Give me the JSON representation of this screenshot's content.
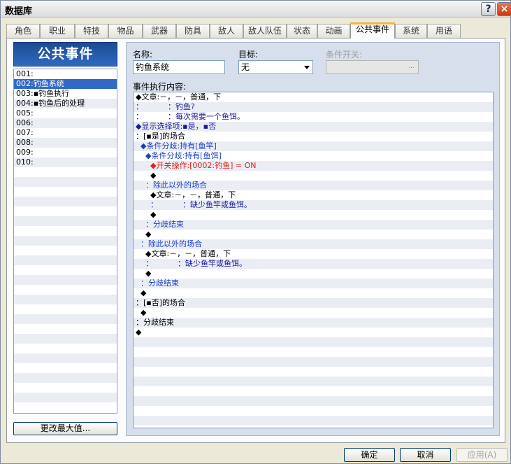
{
  "window": {
    "title": "数据库",
    "help_label": "?",
    "close_label": "×"
  },
  "tabs": [
    {
      "label": "角色"
    },
    {
      "label": "职业"
    },
    {
      "label": "特技"
    },
    {
      "label": "物品"
    },
    {
      "label": "武器"
    },
    {
      "label": "防具"
    },
    {
      "label": "敌人"
    },
    {
      "label": "敌人队伍"
    },
    {
      "label": "状态"
    },
    {
      "label": "动画"
    },
    {
      "label": "公共事件"
    },
    {
      "label": "系统"
    },
    {
      "label": "用语"
    }
  ],
  "active_tab": "公共事件",
  "left": {
    "header": "公共事件",
    "items": [
      {
        "label": "001:"
      },
      {
        "label": "002:钓鱼系统"
      },
      {
        "label": "003:▪钓鱼执行"
      },
      {
        "label": "004:▪钓鱼后的处理"
      },
      {
        "label": "005:"
      },
      {
        "label": "006:"
      },
      {
        "label": "007:"
      },
      {
        "label": "008:"
      },
      {
        "label": "009:"
      },
      {
        "label": "010:"
      }
    ],
    "selected_index": 1,
    "max_button": "更改最大值..."
  },
  "form": {
    "name_label": "名称:",
    "name_value": "钓鱼系统",
    "target_label": "目标:",
    "target_value": "无",
    "switch_label": "条件开关:",
    "switch_button": "...",
    "content_label": "事件执行内容:"
  },
  "commands": [
    {
      "text": "◆文章:－，－，普通，下",
      "color": "#000000"
    },
    {
      "text": "：          ：钓鱼?",
      "color": "#1a1aa0"
    },
    {
      "text": "：          ：每次需要一个鱼饵。",
      "color": "#1a1aa0"
    },
    {
      "text": "◆显示选择项:▪是，▪否",
      "color": "#1a1aa0"
    },
    {
      "text": "：[▪是]的场合",
      "color": "#000000"
    },
    {
      "text": "  ◆条件分歧:持有[鱼竿]",
      "color": "#1a3cc8"
    },
    {
      "text": "    ◆条件分歧:持有[鱼饵]",
      "color": "#1a3cc8"
    },
    {
      "text": "      ◆开关操作:[0002:钓鱼] = ON",
      "color": "#e01c1c"
    },
    {
      "text": "      ◆",
      "color": "#000000"
    },
    {
      "text": "    ：除此以外的场合",
      "color": "#1a3cc8"
    },
    {
      "text": "      ◆文章:－，－，普通，下",
      "color": "#000000"
    },
    {
      "text": "      ：          ：缺少鱼竿或鱼饵。",
      "color": "#1a1aa0"
    },
    {
      "text": "      ◆",
      "color": "#000000"
    },
    {
      "text": "    ：分歧结束",
      "color": "#1a3cc8"
    },
    {
      "text": "    ◆",
      "color": "#000000"
    },
    {
      "text": "  ：除此以外的场合",
      "color": "#1a3cc8"
    },
    {
      "text": "    ◆文章:－，－，普通，下",
      "color": "#000000"
    },
    {
      "text": "    ：          ：缺少鱼竿或鱼饵。",
      "color": "#1a1aa0"
    },
    {
      "text": "    ◆",
      "color": "#000000"
    },
    {
      "text": "  ：分歧结束",
      "color": "#1a3cc8"
    },
    {
      "text": "  ◆",
      "color": "#000000"
    },
    {
      "text": "：[▪否]的场合",
      "color": "#000000"
    },
    {
      "text": "  ◆",
      "color": "#000000"
    },
    {
      "text": "：分歧结束",
      "color": "#000000"
    },
    {
      "text": "◆",
      "color": "#000000"
    }
  ],
  "buttons": {
    "ok": "确定",
    "cancel": "取消",
    "apply": "应用(A)"
  },
  "colors": {
    "selection": "#316ac5",
    "header_blue": "#1c4b93",
    "tab_highlight": "#f1b34c"
  }
}
